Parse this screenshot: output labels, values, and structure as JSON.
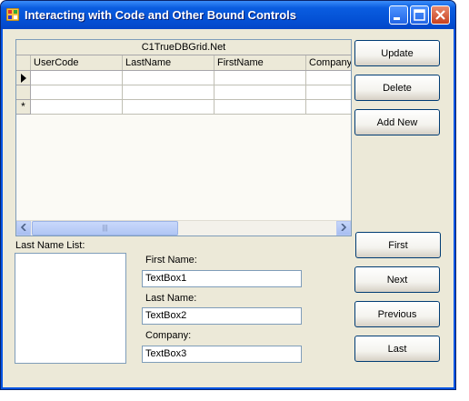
{
  "window": {
    "title": "Interacting with Code and Other Bound Controls"
  },
  "grid": {
    "caption": "C1TrueDBGrid.Net",
    "columns": [
      "UserCode",
      "LastName",
      "FirstName",
      "Company"
    ],
    "new_row_marker": "*",
    "current_row_marker": "▶",
    "scroll_left": "◀",
    "scroll_right": "▶",
    "scroll_grip": "|||"
  },
  "buttons": {
    "update": "Update",
    "delete": "Delete",
    "add_new": "Add New",
    "first": "First",
    "next": "Next",
    "previous": "Previous",
    "last": "Last"
  },
  "last_name_list": {
    "label": "Last Name List:"
  },
  "fields": {
    "first_name_label": "First Name:",
    "first_name_value": "TextBox1",
    "last_name_label": "Last Name:",
    "last_name_value": "TextBox2",
    "company_label": "Company:",
    "company_value": "TextBox3"
  }
}
